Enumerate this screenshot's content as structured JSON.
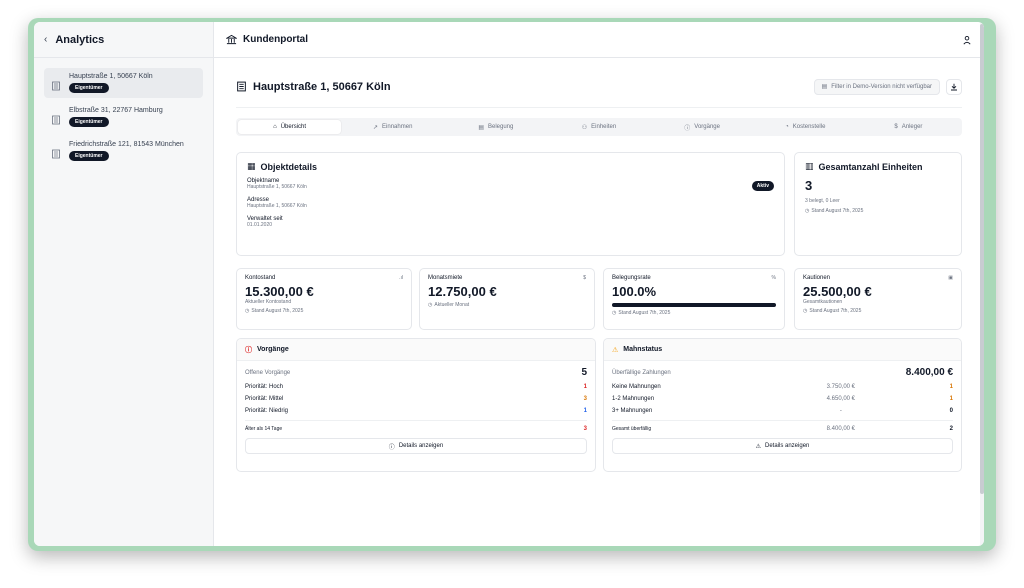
{
  "sidebar": {
    "title": "Analytics",
    "properties": [
      {
        "address": "Hauptstraße 1, 50667 Köln",
        "badge": "Eigentümer"
      },
      {
        "address": "Elbstraße 31, 22767 Hamburg",
        "badge": "Eigentümer"
      },
      {
        "address": "Friedrichstraße 121, 81543 München",
        "badge": "Eigentümer"
      }
    ]
  },
  "topbar": {
    "title": "Kundenportal"
  },
  "page": {
    "title": "Hauptstraße 1, 50667 Köln",
    "filter_label": "Filter in Demo-Version nicht verfügbar"
  },
  "tabs": [
    {
      "label": "Übersicht",
      "icon": "home-icon"
    },
    {
      "label": "Einnahmen",
      "icon": "trend-up-icon"
    },
    {
      "label": "Belegung",
      "icon": "calendar-icon"
    },
    {
      "label": "Einheiten",
      "icon": "users-icon"
    },
    {
      "label": "Vorgänge",
      "icon": "alert-circle-icon"
    },
    {
      "label": "Kostenstelle",
      "icon": "pie-icon"
    },
    {
      "label": "Anleger",
      "icon": "dollar-icon"
    }
  ],
  "objekt": {
    "title": "Objektdetails",
    "status": "Aktiv",
    "name_label": "Objektname",
    "name_value": "Hauptstraße 1, 50667 Köln",
    "address_label": "Adresse",
    "address_value": "Hauptstraße 1, 50667 Köln",
    "since_label": "Verwaltet seit",
    "since_value": "01.01.2020"
  },
  "einheiten": {
    "title": "Gesamtanzahl Einheiten",
    "value": "3",
    "detail": "3 belegt, 0 Leer",
    "stand": "Stand August 7th, 2025"
  },
  "stats": [
    {
      "label": "Kontostand",
      "value": "15.300,00 €",
      "sub": "Aktueller Kontostand",
      "stand": "Stand August 7th, 2025",
      "icon": "bar-chart-icon",
      "icon_glyph": ".ıl"
    },
    {
      "label": "Monatsmiete",
      "value": "12.750,00 €",
      "sub": "",
      "stand": "Aktueller Monat",
      "icon": "dollar-icon",
      "icon_glyph": "$"
    },
    {
      "label": "Belegungsrate",
      "value": "100.0%",
      "sub": "",
      "stand": "Stand August 7th, 2025",
      "icon": "percent-icon",
      "icon_glyph": "%",
      "progress": 1.0
    },
    {
      "label": "Kautionen",
      "value": "25.500,00 €",
      "sub": "Gesamtkautionen",
      "stand": "Stand August 7th, 2025",
      "icon": "safe-icon",
      "icon_glyph": "▣"
    }
  ],
  "vorgaenge": {
    "title": "Vorgänge",
    "open_label": "Offene Vorgänge",
    "open_value": "5",
    "rows": [
      {
        "label": "Priorität: Hoch",
        "value": "1",
        "color": "#dc2626"
      },
      {
        "label": "Priorität: Mittel",
        "value": "3",
        "color": "#d97706"
      },
      {
        "label": "Priorität: Niedrig",
        "value": "1",
        "color": "#2563eb"
      }
    ],
    "older_label": "Älter als 14 Tage",
    "older_value": "3",
    "older_color": "#dc2626",
    "button": "Details anzeigen"
  },
  "mahnstatus": {
    "title": "Mahnstatus",
    "overdue_label": "Überfällige Zahlungen",
    "overdue_value": "8.400,00 €",
    "rows": [
      {
        "label": "Keine Mahnungen",
        "amount": "3.750,00 €",
        "count": "1",
        "color": "#d97706"
      },
      {
        "label": "1-2 Mahnungen",
        "amount": "4.650,00 €",
        "count": "1",
        "color": "#d97706"
      },
      {
        "label": "3+ Mahnungen",
        "amount": "-",
        "count": "0",
        "color": "#111827"
      }
    ],
    "total_label": "Gesamt überfällig",
    "total_amount": "8.400,00 €",
    "total_count": "2",
    "button": "Details anzeigen"
  },
  "colors": {
    "accent": "#111827",
    "warning": "#f59e0b",
    "danger": "#dc2626"
  }
}
